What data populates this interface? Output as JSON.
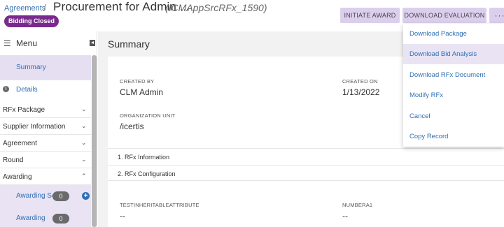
{
  "header": {
    "breadcrumb": "Agreements",
    "breadcrumb_sep": "/",
    "title": "Procurement for Admin ...",
    "subtitle": "(ICMAppSrcRFx_1590)",
    "status_badge": "Bidding Closed",
    "buttons": {
      "initiate": "INITIATE AWARD",
      "download": "DOWNLOAD EVALUATION",
      "more": "···"
    }
  },
  "sidebar": {
    "menu_label": "Menu",
    "items": [
      {
        "label": "Summary"
      },
      {
        "label": "Details"
      }
    ],
    "sections": [
      {
        "label": "RFx Package"
      },
      {
        "label": "Supplier Information"
      },
      {
        "label": "Agreement"
      },
      {
        "label": "Round"
      },
      {
        "label": "Awarding"
      }
    ],
    "subitems": [
      {
        "label": "Awarding Scenarios",
        "count": "0"
      },
      {
        "label": "Awarding",
        "count": "0"
      }
    ]
  },
  "main": {
    "title": "Summary",
    "fields": {
      "created_by_label": "CREATED BY",
      "created_by": "CLM Admin",
      "created_on_label": "CREATED ON",
      "created_on": "1/13/2022",
      "org_unit_label": "ORGANIZATION UNIT",
      "org_unit": "/icertis",
      "test_attr_label": "TESTINHERITABLEATTRIBUTE",
      "test_attr": "--",
      "number_label": "NUMBERA1",
      "number": "--"
    },
    "accordions": [
      {
        "label": "1. RFx Information"
      },
      {
        "label": "2. RFx Configuration"
      }
    ]
  },
  "dropdown": {
    "items": [
      {
        "label": "Download Package"
      },
      {
        "label": "Download Bid Analysis"
      },
      {
        "label": "Download RFx Document"
      },
      {
        "label": "Modify RFx"
      },
      {
        "label": "Cancel"
      },
      {
        "label": "Copy Record"
      }
    ]
  }
}
